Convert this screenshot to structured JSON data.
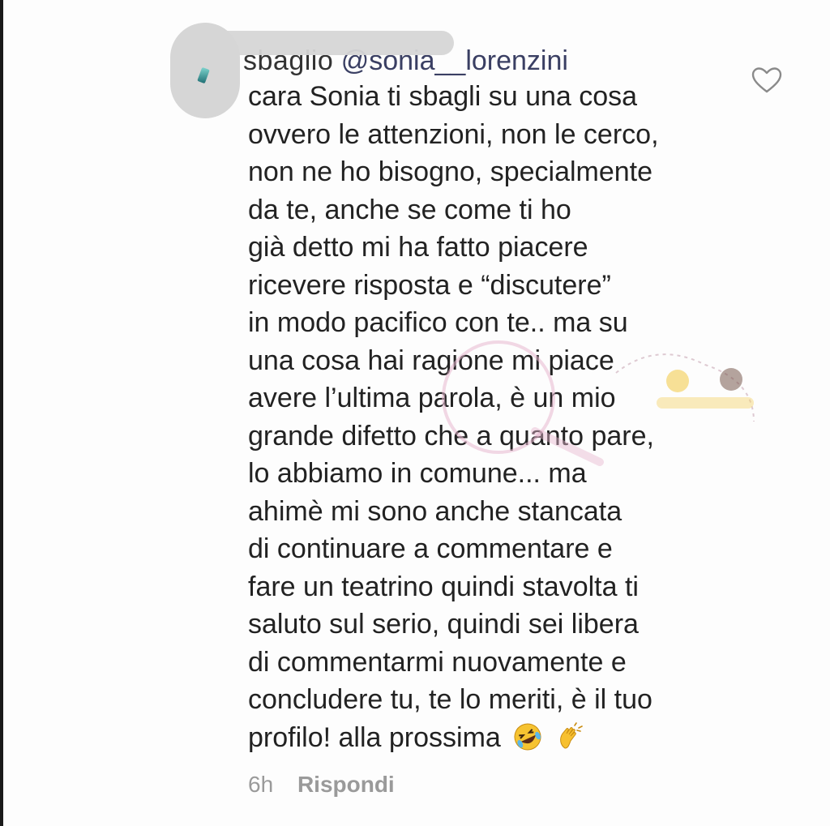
{
  "comment": {
    "username_visible": "sbaglio",
    "mention": "@sonia__lorenzini",
    "lines": [
      "cara Sonia ti sbagli su una cosa",
      "ovvero le attenzioni, non le cerco,",
      "non ne ho bisogno, specialmente",
      "da te, anche se come ti ho",
      "già detto mi ha fatto piacere",
      "ricevere risposta e “discutere”",
      "in modo pacifico con te.. ma su",
      "una cosa hai ragione mi piace",
      "avere l’ultima parola, è un mio",
      "grande difetto che a quanto pare,",
      "lo abbiamo in comune... ma",
      "ahimè mi sono anche stancata",
      "di continuare a commentare e",
      "fare un teatrino quindi stavolta ti",
      "saluto sul serio, quindi sei libera",
      "di commentarmi nuovamente e",
      "concludere tu, te lo meriti, è il tuo",
      "profilo! alla prossima"
    ],
    "emojis": [
      "rolling-on-floor-laughing-emoji",
      "clapping-hands-emoji"
    ],
    "timestamp": "6h",
    "reply_label": "Rispondi",
    "like_icon": "heart-outline-icon"
  },
  "colors": {
    "text": "#222222",
    "mention": "#3a3f63",
    "meta": "#9a9a9a",
    "redaction": "#d6d6d6"
  }
}
